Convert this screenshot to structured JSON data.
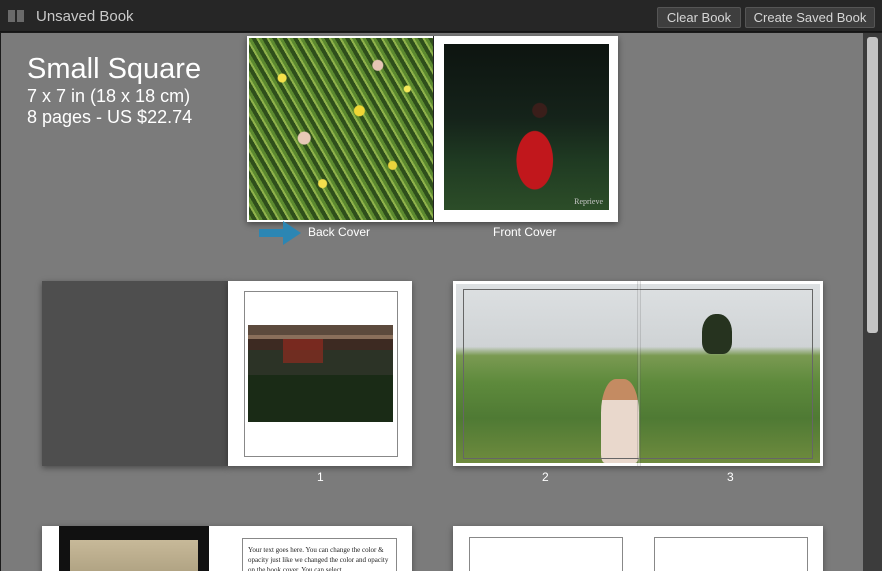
{
  "window": {
    "title": "Unsaved Book"
  },
  "toolbar": {
    "clear_label": "Clear Book",
    "create_label": "Create Saved Book"
  },
  "book": {
    "size": "Small Square",
    "dimensions": "7 x 7 in (18 x 18 cm)",
    "pages_price": "8 pages - US $22.74"
  },
  "cover": {
    "back_label": "Back Cover",
    "front_label": "Front Cover",
    "front_watermark": "Reprieve"
  },
  "spreads": {
    "page_1": "1",
    "page_2": "2",
    "page_3": "3"
  },
  "text_page": {
    "body": "Your text goes here. You can change the color & opacity just like we changed the color and opacity on the book cover. You can select"
  },
  "colors": {
    "accent_arrow": "#2c86b3",
    "canvas_bg": "#7b7b7b"
  }
}
